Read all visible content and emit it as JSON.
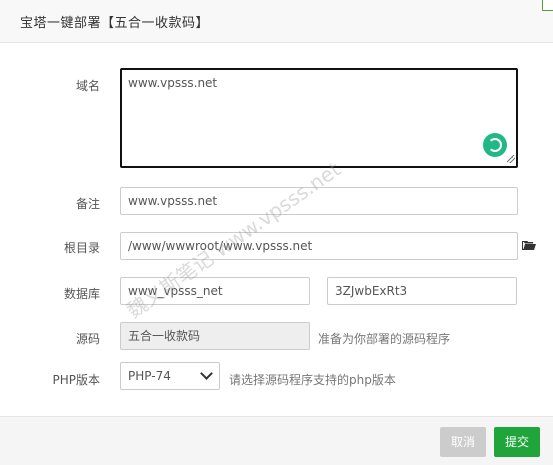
{
  "dialog": {
    "title": "宝塔一键部署【五合一收款码】"
  },
  "form": {
    "domain": {
      "label": "域名",
      "value": "www.vpsss.net"
    },
    "remark": {
      "label": "备注",
      "value": "www.vpsss.net"
    },
    "root_dir": {
      "label": "根目录",
      "value": "/www/wwwroot/www.vpsss.net"
    },
    "database": {
      "label": "数据库",
      "name": "www_vpsss_net",
      "password": "3ZJwbExRt3"
    },
    "source": {
      "label": "源码",
      "value": "五合一收款码",
      "hint": "准备为你部署的源码程序"
    },
    "php": {
      "label": "PHP版本",
      "selected": "PHP-74",
      "hint": "请选择源码程序支持的php版本"
    }
  },
  "watermark": "魏义斯笔记 www.vpsss.net",
  "footer": {
    "cancel_label": "取消",
    "submit_label": "提交"
  },
  "colors": {
    "accent": "#20a53a",
    "spinner": "#20b985"
  },
  "icons": {
    "folder": "folder-icon",
    "spinner": "loading-icon"
  }
}
